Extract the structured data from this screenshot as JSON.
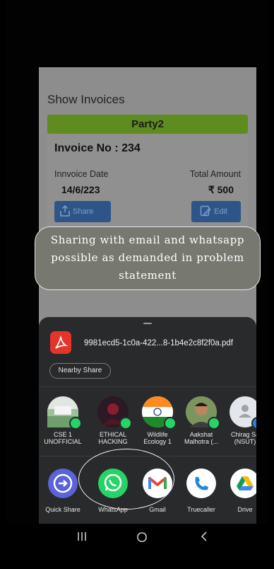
{
  "app": {
    "title": "Show Invoices",
    "party": "Party2",
    "invoice_no": "Invoice No : 234",
    "date_label": "Innvoice Date",
    "date_value": "14/6/223",
    "total_label": "Total Amount",
    "total_value": "₹ 500",
    "share_label": "Share",
    "edit_label": "Edit"
  },
  "annotation": {
    "line1": "Sharing with email and whatsapp",
    "line2": "possible as demanded in problem",
    "line3": "statement"
  },
  "share_sheet": {
    "filename": "9981ecd5-1c0a-422...8-1b4e2c8f2f0a.pdf",
    "nearby_share": "Nearby Share",
    "contacts": [
      {
        "name1": "CSE 1",
        "name2": "UNOFFICIAL"
      },
      {
        "name1": "ETHICAL",
        "name2": "HACKING"
      },
      {
        "name1": "Wildlife",
        "name2": "Ecology 1"
      },
      {
        "name1": "Aakshat",
        "name2": "Malhotra (..."
      },
      {
        "name1": "Chirag Sa",
        "name2": "(NSUT)"
      }
    ],
    "apps": [
      {
        "name": "Quick Share",
        "icon": "quick-share-icon"
      },
      {
        "name": "WhatsApp",
        "icon": "whatsapp-icon"
      },
      {
        "name": "Gmail",
        "icon": "gmail-icon"
      },
      {
        "name": "Truecaller",
        "icon": "truecaller-icon"
      },
      {
        "name": "Drive",
        "icon": "drive-icon"
      }
    ]
  },
  "colors": {
    "party_bar": "#5e8c1f",
    "whatsapp": "#25d366",
    "sheet_bg": "#292a2b"
  }
}
